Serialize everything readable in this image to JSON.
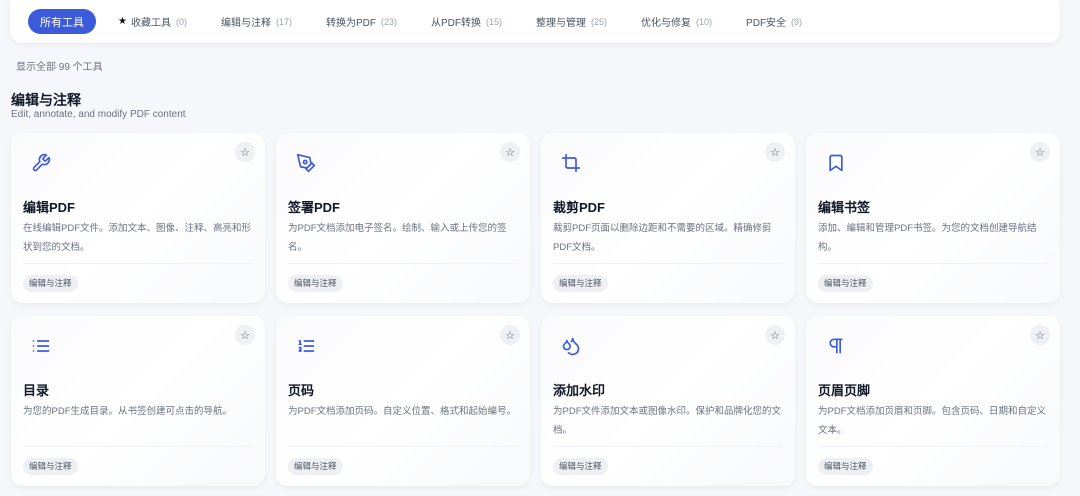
{
  "tabs": [
    {
      "label": "所有工具",
      "count": ""
    },
    {
      "label": "收藏工具",
      "count": "(0)"
    },
    {
      "label": "编辑与注释",
      "count": "(17)"
    },
    {
      "label": "转换为PDF",
      "count": "(23)"
    },
    {
      "label": "从PDF转换",
      "count": "(15)"
    },
    {
      "label": "整理与管理",
      "count": "(25)"
    },
    {
      "label": "优化与修复",
      "count": "(10)"
    },
    {
      "label": "PDF安全",
      "count": "(9)"
    }
  ],
  "count_text": "显示全部 99 个工具",
  "section": {
    "title": "编辑与注释",
    "subtitle": "Edit, annotate, and modify PDF content"
  },
  "cards": [
    {
      "icon": "wrench-icon",
      "title": "编辑PDF",
      "desc": "在线编辑PDF文件。添加文本、图像、注释、高亮和形状到您的文档。",
      "tag": "编辑与注释"
    },
    {
      "icon": "pen-nib-icon",
      "title": "签署PDF",
      "desc": "为PDF文档添加电子签名。绘制、输入或上传您的签名。",
      "tag": "编辑与注释"
    },
    {
      "icon": "crop-icon",
      "title": "裁剪PDF",
      "desc": "裁剪PDF页面以删除边距和不需要的区域。精确修剪PDF文档。",
      "tag": "编辑与注释"
    },
    {
      "icon": "bookmark-icon",
      "title": "编辑书签",
      "desc": "添加、编辑和管理PDF书签。为您的文档创建导航结构。",
      "tag": "编辑与注释"
    },
    {
      "icon": "list-icon",
      "title": "目录",
      "desc": "为您的PDF生成目录。从书签创建可点击的导航。",
      "tag": "编辑与注释"
    },
    {
      "icon": "numbered-list-icon",
      "title": "页码",
      "desc": "为PDF文档添加页码。自定义位置、格式和起始编号。",
      "tag": "编辑与注释"
    },
    {
      "icon": "droplets-icon",
      "title": "添加水印",
      "desc": "为PDF文件添加文本或图像水印。保护和品牌化您的文档。",
      "tag": "编辑与注释"
    },
    {
      "icon": "pilcrow-icon",
      "title": "页眉页脚",
      "desc": "为PDF文档添加页眉和页脚。包含页码、日期和自定义文本。",
      "tag": "编辑与注释"
    }
  ],
  "colors": {
    "accent": "#3b5bdb"
  }
}
